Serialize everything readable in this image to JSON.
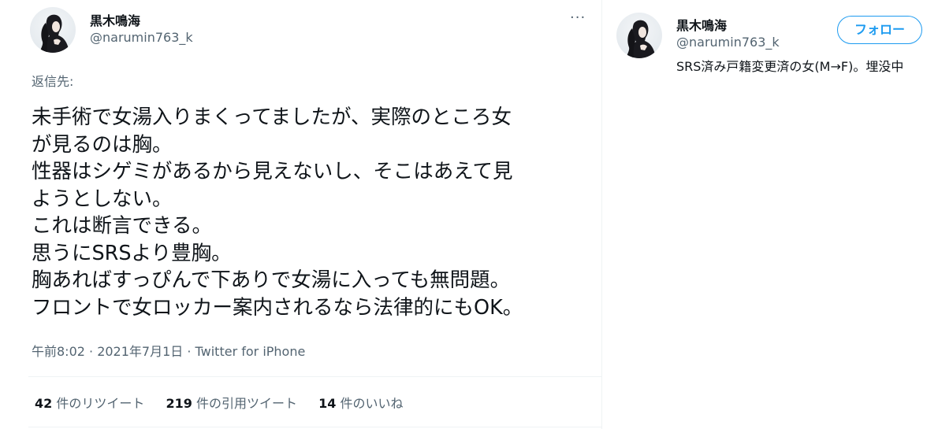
{
  "tweet": {
    "author_name": "黒木鳴海",
    "author_handle": "@narumin763_k",
    "more_label": "···",
    "replying_to": "返信先:",
    "text_lines": [
      "未手術で女湯入りまくってましたが、実際のところ女",
      "が見るのは胸。",
      "性器はシゲミがあるから見えないし、そこはあえて見",
      "ようとしない。",
      "これは断言できる。",
      "思うにSRSより豊胸。",
      "胸あればすっぴんで下ありで女湯に入っても無問題。",
      "フロントで女ロッカー案内されるなら法律的にもOK。"
    ],
    "meta": "午前8:02 · 2021年7月1日 · Twitter for iPhone",
    "stats": [
      {
        "count": "42",
        "label": "件のリツイート"
      },
      {
        "count": "219",
        "label": "件の引用ツイート"
      },
      {
        "count": "14",
        "label": "件のいいね"
      }
    ]
  },
  "profile_card": {
    "name": "黒木鳴海",
    "handle": "@narumin763_k",
    "follow_label": "フォロー",
    "bio": "SRS済み戸籍変更済の女(M→F)。埋没中"
  },
  "colors": {
    "accent": "#1d9bf0",
    "text_primary": "#0f1419",
    "text_secondary": "#536471",
    "border": "#eff3f4"
  },
  "icons": {
    "more": "more-horizontal-icon",
    "avatar": "avatar-image"
  }
}
